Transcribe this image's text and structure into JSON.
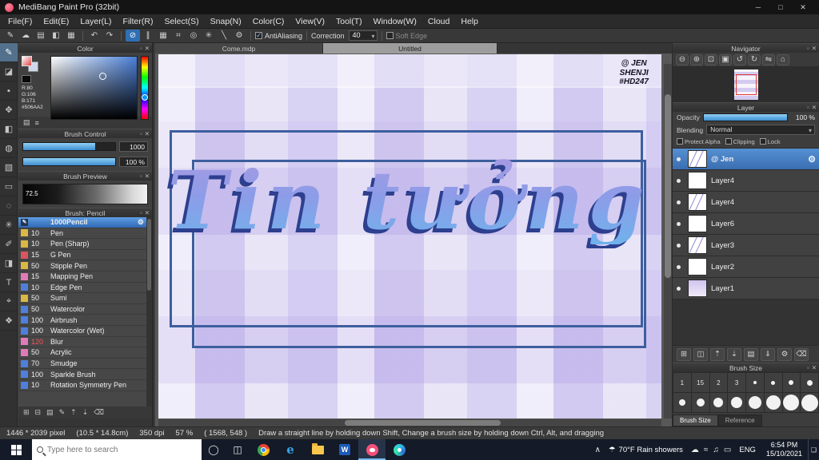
{
  "ui": {
    "detach_glyph": "▫",
    "close_glyph": "✕"
  },
  "titlebar": {
    "title": "MediBang Paint Pro (32bit)",
    "minimize_glyph": "─",
    "maximize_glyph": "□",
    "close_glyph": "✕"
  },
  "menubar": {
    "items": [
      "File(F)",
      "Edit(E)",
      "Layer(L)",
      "Filter(R)",
      "Select(S)",
      "Snap(N)",
      "Color(C)",
      "View(V)",
      "Tool(T)",
      "Window(W)",
      "Cloud",
      "Help"
    ]
  },
  "toolbar": {
    "icons": [
      {
        "name": "brush-icon",
        "glyph": "✎"
      },
      {
        "name": "cloud-icon",
        "glyph": "☁"
      },
      {
        "name": "save-icon",
        "glyph": "▤"
      },
      {
        "name": "palette-icon",
        "glyph": "◧"
      },
      {
        "name": "grid-icon",
        "glyph": "▦"
      },
      {
        "name": "undo-icon",
        "glyph": "↶"
      },
      {
        "name": "redo-icon",
        "glyph": "↷"
      },
      {
        "name": "snap-off-icon",
        "glyph": "⊘"
      },
      {
        "name": "snap-parallel-icon",
        "glyph": "∥"
      },
      {
        "name": "snap-grid-icon",
        "glyph": "▦"
      },
      {
        "name": "snap-cross-icon",
        "glyph": "⌗"
      },
      {
        "name": "snap-circle-icon",
        "glyph": "◎"
      },
      {
        "name": "snap-radial-icon",
        "glyph": "✳"
      },
      {
        "name": "snap-curve-icon",
        "glyph": "╲"
      },
      {
        "name": "snap-settings-icon",
        "glyph": "⚙"
      }
    ],
    "antialiasing_label": "AntiAliasing",
    "correction_label": "Correction",
    "correction_value": "40",
    "soft_edge_label": "Soft Edge"
  },
  "toolstrip": {
    "tools": [
      {
        "name": "brush-tool",
        "glyph": "✎"
      },
      {
        "name": "eraser-tool",
        "glyph": "◪"
      },
      {
        "name": "dot-tool",
        "glyph": "▪"
      },
      {
        "name": "move-tool",
        "glyph": "✥"
      },
      {
        "name": "fill-tool",
        "glyph": "◧"
      },
      {
        "name": "bucket-tool",
        "glyph": "◍"
      },
      {
        "name": "gradient-tool",
        "glyph": "▧"
      },
      {
        "name": "select-tool",
        "glyph": "▭"
      },
      {
        "name": "lasso-tool",
        "glyph": "◌"
      },
      {
        "name": "magic-wand-tool",
        "glyph": "✳"
      },
      {
        "name": "select-pen-tool",
        "glyph": "✐"
      },
      {
        "name": "select-eraser-tool",
        "glyph": "◨"
      },
      {
        "name": "text-tool",
        "glyph": "T"
      },
      {
        "name": "eyedropper-tool",
        "glyph": "⌖"
      },
      {
        "name": "hand-tool",
        "glyph": "❖"
      }
    ]
  },
  "panels": {
    "color": {
      "title": "Color",
      "r": "R:80",
      "g": "G:106",
      "b": "B:171",
      "hex": "#506AA2",
      "footer_icons": [
        {
          "name": "palette-icon",
          "glyph": "▤"
        },
        {
          "name": "sliders-icon",
          "glyph": "≡"
        }
      ]
    },
    "brush_control": {
      "title": "Brush Control",
      "size_value": "1000",
      "opacity_value": "100 %"
    },
    "brush_preview": {
      "title": "Brush Preview",
      "size_display": "72.5"
    },
    "brush_list": {
      "title": "Brush: Pencil",
      "brushes": [
        {
          "size": "",
          "name": "1000Pencil",
          "color": "#24364f",
          "icon": "✎"
        },
        {
          "size": "10",
          "name": "Pen",
          "color": "#d9b944"
        },
        {
          "size": "10",
          "name": "Pen (Sharp)",
          "color": "#d9b944"
        },
        {
          "size": "15",
          "name": "G Pen",
          "color": "#d95560"
        },
        {
          "size": "50",
          "name": "Stipple Pen",
          "color": "#d9b944"
        },
        {
          "size": "15",
          "name": "Mapping Pen",
          "color": "#e07ab8"
        },
        {
          "size": "10",
          "name": "Edge Pen",
          "color": "#4f7fd9"
        },
        {
          "size": "50",
          "name": "Sumi",
          "color": "#d9b944"
        },
        {
          "size": "50",
          "name": "Watercolor",
          "color": "#4f7fd9"
        },
        {
          "size": "100",
          "name": "Airbrush",
          "color": "#4f7fd9"
        },
        {
          "size": "100",
          "name": "Watercolor (Wet)",
          "color": "#4f7fd9"
        },
        {
          "size": "120",
          "name": "Blur",
          "color": "#e07ab8",
          "size_color": "#ff5252"
        },
        {
          "size": "50",
          "name": "Acrylic",
          "color": "#e07ab8"
        },
        {
          "size": "70",
          "name": "Smudge",
          "color": "#4f7fd9"
        },
        {
          "size": "100",
          "name": "Sparkle Brush",
          "color": "#4f7fd9"
        },
        {
          "size": "10",
          "name": "Rotation Symmetry Pen",
          "color": "#4f7fd9"
        }
      ],
      "footer_icons": [
        {
          "name": "add-brush-icon",
          "glyph": "⊞"
        },
        {
          "name": "remove-brush-icon",
          "glyph": "⊟"
        },
        {
          "name": "brush-folder-icon",
          "glyph": "▤"
        },
        {
          "name": "edit-brush-icon",
          "glyph": "✎"
        },
        {
          "name": "brush-up-icon",
          "glyph": "⇡"
        },
        {
          "name": "brush-down-icon",
          "glyph": "⇣"
        },
        {
          "name": "delete-brush-icon",
          "glyph": "⌫"
        }
      ]
    }
  },
  "canvas": {
    "tabs": [
      "Come.mdp",
      "Untitled"
    ],
    "artwork_text": "Tin tưởng",
    "signature": [
      "@ JEN",
      "SHENJI",
      "#HD247"
    ]
  },
  "navigator": {
    "title": "Navigator",
    "buttons": [
      {
        "name": "zoom-out-icon",
        "glyph": "⊖"
      },
      {
        "name": "zoom-in-icon",
        "glyph": "⊕"
      },
      {
        "name": "fit-screen-icon",
        "glyph": "⊡"
      },
      {
        "name": "actual-size-icon",
        "glyph": "▣"
      },
      {
        "name": "rotate-left-icon",
        "glyph": "↺"
      },
      {
        "name": "rotate-right-icon",
        "glyph": "↻"
      },
      {
        "name": "flip-horizontal-icon",
        "glyph": "⇋"
      },
      {
        "name": "reset-view-icon",
        "glyph": "⌂"
      }
    ]
  },
  "layer_panel": {
    "title": "Layer",
    "opacity_label": "Opacity",
    "opacity_value": "100 %",
    "blending_label": "Blending",
    "blending_value": "Normal",
    "protect_alpha_label": "Protect Alpha",
    "clipping_label": "Clipping",
    "lock_label": "Lock",
    "layers": [
      {
        "name": "@ Jen"
      },
      {
        "name": "Layer4"
      },
      {
        "name": "Layer4"
      },
      {
        "name": "Layer6"
      },
      {
        "name": "Layer3"
      },
      {
        "name": "Layer2"
      },
      {
        "name": "Layer1"
      }
    ],
    "settings_glyph": "⚙",
    "footer_icons": [
      {
        "name": "add-layer-icon",
        "glyph": "⊞"
      },
      {
        "name": "duplicate-layer-icon",
        "glyph": "◫"
      },
      {
        "name": "layer-up-icon",
        "glyph": "⇡"
      },
      {
        "name": "layer-down-icon",
        "glyph": "⇣"
      },
      {
        "name": "layer-folder-icon",
        "glyph": "▤"
      },
      {
        "name": "merge-layer-icon",
        "glyph": "⇓"
      },
      {
        "name": "layer-settings-icon",
        "glyph": "⚙"
      },
      {
        "name": "delete-layer-icon",
        "glyph": "⌫"
      }
    ]
  },
  "brush_size_panel": {
    "title": "Brush Size",
    "preset_labels": [
      "1",
      "15",
      "2",
      "3"
    ],
    "tabs": [
      "Brush Size",
      "Reference"
    ]
  },
  "statusbar": {
    "dimensions": "1446 * 2039 pixel",
    "size_cm": "(10.5 * 14.8cm)",
    "dpi": "350 dpi",
    "zoom": "57 %",
    "coords": "( 1568, 548 )",
    "hint": "Draw a straight line by holding down Shift, Change a brush size by holding down Ctrl, Alt, and dragging"
  },
  "taskbar": {
    "search_placeholder": "Type here to search",
    "apps": [
      {
        "name": "cortana",
        "glyph": "◯"
      },
      {
        "name": "task-view",
        "glyph": "◫"
      },
      {
        "name": "edge",
        "glyph": "e"
      },
      {
        "name": "word",
        "glyph": "W"
      }
    ],
    "weather_glyph": "☂",
    "weather": "70°F Rain showers",
    "tray": {
      "chevron": "∧",
      "cloud": "☁",
      "wifi": "≈",
      "volume": "♫",
      "battery": "▭"
    },
    "language": "ENG",
    "time": "6:54 PM",
    "date": "15/10/2021",
    "notification_glyph": "❏"
  }
}
